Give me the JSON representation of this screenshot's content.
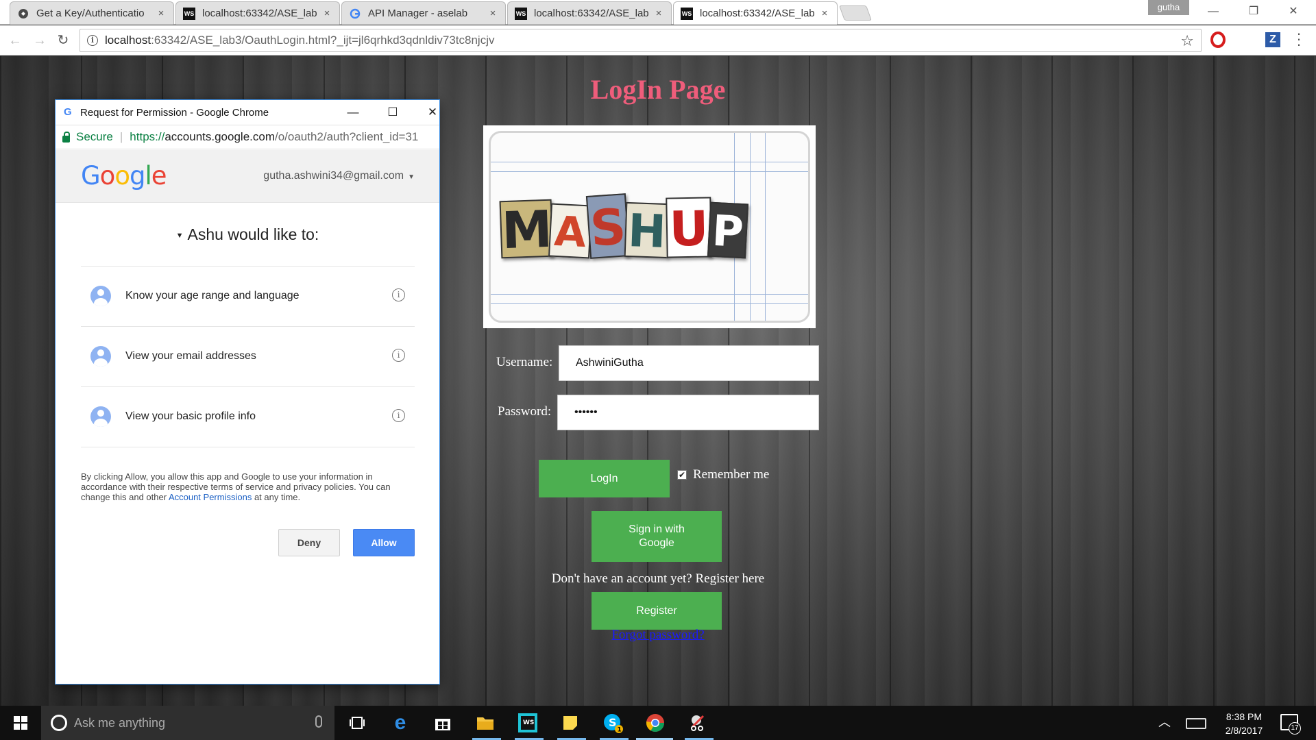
{
  "browser": {
    "tabs": [
      {
        "title": "Get a Key/Authenticatio",
        "favicon": "google-dev-icon",
        "active": false
      },
      {
        "title": "localhost:63342/ASE_lab",
        "favicon": "webstorm-icon",
        "active": false
      },
      {
        "title": "API Manager - aselab",
        "favicon": "google-g-icon",
        "active": false
      },
      {
        "title": "localhost:63342/ASE_lab",
        "favicon": "webstorm-icon",
        "active": false
      },
      {
        "title": "localhost:63342/ASE_lab",
        "favicon": "webstorm-icon",
        "active": true
      }
    ],
    "profile_name": "gutha",
    "address": {
      "host": "localhost",
      "rest": ":63342/ASE_lab3/OauthLogin.html?_ijt=jl6qrhkd3qdnldiv73tc8njcjv"
    },
    "tab_close_glyph": "×",
    "favicon_ws_text": "WS"
  },
  "page": {
    "title": "LogIn Page",
    "logo_letters": [
      "M",
      "A",
      "S",
      "H",
      "U",
      "P"
    ],
    "username_label": "Username:",
    "username_value": "AshwiniGutha",
    "password_label": "Password:",
    "password_value": "••••••",
    "login_button": "LogIn",
    "remember_label": "Remember me",
    "remember_checked": true,
    "google_signin_button": "Sign in with Google",
    "register_prompt": "Don't have an account yet? Register here",
    "register_button": "Register",
    "forgot_link": "Forgot password?",
    "colors": {
      "title": "#ef5d7b",
      "button_green": "#4caf50",
      "link_blue": "#1a1aff"
    }
  },
  "popup": {
    "window_title": "Request for Permission - Google Chrome",
    "secure_label": "Secure",
    "url_scheme": "https://",
    "url_host": "accounts.google.com",
    "url_path": "/o/oauth2/auth?client_id=31",
    "account_email": "gutha.ashwini34@gmail.com",
    "request_heading": "Ashu would like to:",
    "permissions": [
      {
        "label": "Know your age range and language",
        "icon": "profile-avatar-icon"
      },
      {
        "label": "View your email addresses",
        "icon": "profile-avatar-icon"
      },
      {
        "label": "View your basic profile info",
        "icon": "profile-avatar-icon"
      }
    ],
    "consent_prefix": "By clicking Allow, you allow this app and Google to use your information in accordance with their respective terms of service and privacy policies. You can change this and other ",
    "consent_link": "Account Permissions",
    "consent_suffix": " at any time.",
    "deny_button": "Deny",
    "allow_button": "Allow"
  },
  "taskbar": {
    "search_placeholder": "Ask me anything",
    "clock_time": "8:38 PM",
    "clock_date": "2/8/2017",
    "notification_count": "17",
    "skype_badge": "1"
  }
}
